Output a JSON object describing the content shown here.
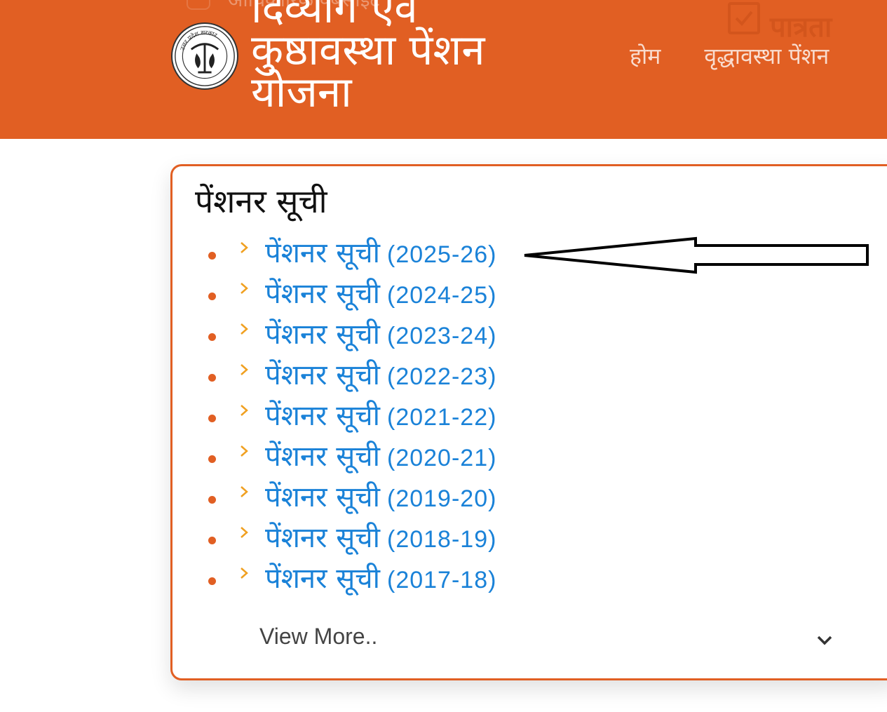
{
  "header": {
    "site_title": "दिव्यांग एवं कुष्ठावस्था पेंशन योजना",
    "top_strip_text": "आधिकारिक वेबसाइट",
    "eligibility_label": "पात्रता",
    "logo_text": "उत्तर प्रदेश सरकार",
    "bg_color": "#e15f23"
  },
  "nav": {
    "items": [
      {
        "label": "होम"
      },
      {
        "label": "वृद्धावस्था पेंशन"
      }
    ]
  },
  "pensioner_list": {
    "title": "पेंशनर सूची",
    "items": [
      {
        "label": "पेंशनर सूची",
        "year": "(2025-26)"
      },
      {
        "label": "पेंशनर सूची",
        "year": "(2024-25)"
      },
      {
        "label": "पेंशनर सूची",
        "year": "(2023-24)"
      },
      {
        "label": "पेंशनर सूची",
        "year": "(2022-23)"
      },
      {
        "label": "पेंशनर सूची",
        "year": "(2021-22)"
      },
      {
        "label": "पेंशनर सूची",
        "year": "(2020-21)"
      },
      {
        "label": "पेंशनर सूची",
        "year": "(2019-20)"
      },
      {
        "label": "पेंशनर सूची",
        "year": "(2018-19)"
      },
      {
        "label": "पेंशनर सूची",
        "year": "(2017-18)"
      }
    ],
    "view_more": "View More..",
    "link_color": "#1a82d8",
    "bullet_color": "#e15f23",
    "chevron_color": "#f0a020"
  },
  "annotation": {
    "icon": "arrow-left-icon"
  }
}
